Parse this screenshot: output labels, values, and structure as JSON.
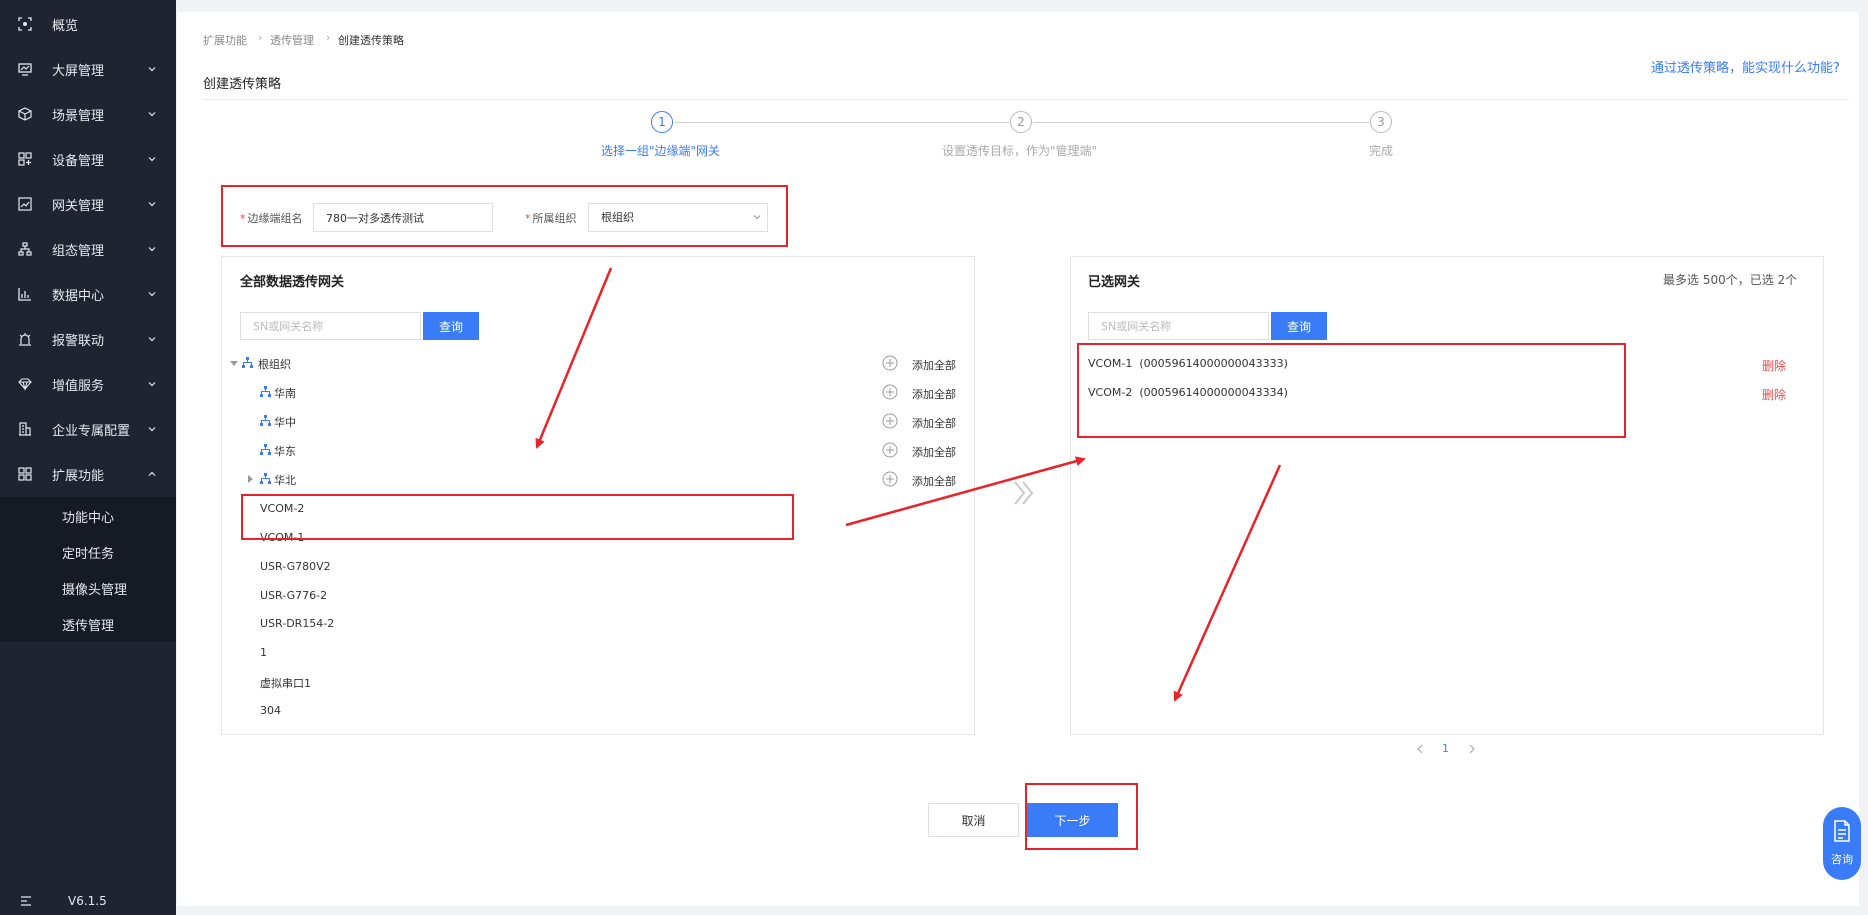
{
  "sidebar": {
    "items": [
      {
        "label": "概览",
        "icon": "overview-icon",
        "has_children": false
      },
      {
        "label": "大屏管理",
        "icon": "screen-icon",
        "has_children": true
      },
      {
        "label": "场景管理",
        "icon": "cube-icon",
        "has_children": true
      },
      {
        "label": "设备管理",
        "icon": "device-icon",
        "has_children": true
      },
      {
        "label": "网关管理",
        "icon": "gateway-icon",
        "has_children": true
      },
      {
        "label": "组态管理",
        "icon": "topology-icon",
        "has_children": true
      },
      {
        "label": "数据中心",
        "icon": "bar-chart-icon",
        "has_children": true
      },
      {
        "label": "报警联动",
        "icon": "alarm-icon",
        "has_children": true
      },
      {
        "label": "增值服务",
        "icon": "diamond-icon",
        "has_children": true
      },
      {
        "label": "企业专属配置",
        "icon": "building-icon",
        "has_children": true
      },
      {
        "label": "扩展功能",
        "icon": "grid-icon",
        "has_children": true,
        "expanded": true
      }
    ],
    "submenu": [
      "功能中心",
      "定时任务",
      "摄像头管理",
      "透传管理"
    ],
    "version": "V6.1.5"
  },
  "breadcrumb": [
    "扩展功能",
    "透传管理",
    "创建透传策略"
  ],
  "page_title": "创建透传策略",
  "help_link": "通过透传策略，能实现什么功能?",
  "steps": [
    {
      "num": "1",
      "label": "选择一组\"边缘端\"网关",
      "active": true
    },
    {
      "num": "2",
      "label": "设置透传目标，作为\"管理端\"",
      "active": false
    },
    {
      "num": "3",
      "label": "完成",
      "active": false
    }
  ],
  "form": {
    "group_name_label": "边缘端组名",
    "group_name_value": "780一对多透传测试",
    "org_label": "所属组织",
    "org_value": "根组织"
  },
  "left_panel": {
    "title": "全部数据透传网关",
    "search_placeholder": "SN或网关名称",
    "query_label": "查询",
    "add_all_label": "添加全部",
    "tree": [
      {
        "label": "根组织",
        "expanded": true,
        "level": 0
      },
      {
        "label": "华南",
        "level": 1
      },
      {
        "label": "华中",
        "level": 1
      },
      {
        "label": "华东",
        "level": 1
      },
      {
        "label": "华北",
        "level": 1,
        "collapsed_arrow": true
      }
    ],
    "gateways": [
      "VCOM-2",
      "VCOM-1",
      "USR-G780V2",
      "USR-G776-2",
      "USR-DR154-2",
      "1",
      "虚拟串口1",
      "304"
    ]
  },
  "right_panel": {
    "title": "已选网关",
    "meta": "最多选 500个，已选 2个",
    "search_placeholder": "SN或网关名称",
    "query_label": "查询",
    "delete_label": "删除",
    "selected": [
      {
        "name": "VCOM-1",
        "sn": "(00059614000000043333)"
      },
      {
        "name": "VCOM-2",
        "sn": "(00059614000000043334)"
      }
    ],
    "page": "1"
  },
  "buttons": {
    "cancel": "取消",
    "next": "下一步"
  },
  "consult_label": "咨询",
  "colors": {
    "primary": "#3a7bf7",
    "sidebar_bg": "#1f2430",
    "danger": "#ee4a4a",
    "annotation": "#e8232a"
  }
}
